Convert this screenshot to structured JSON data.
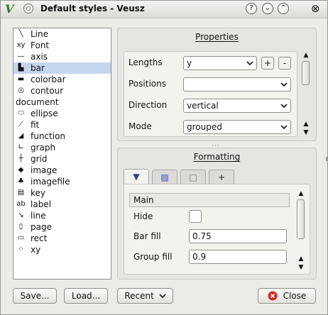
{
  "window": {
    "title": "Default styles - Veusz",
    "app_icon": "V"
  },
  "titlebar_buttons": [
    "help-icon",
    "minimize-icon",
    "maximize-icon",
    "close-icon"
  ],
  "title_glyphs": {
    "help": "?",
    "minimize": "⌄",
    "maximize": "⌃",
    "close": "⊗"
  },
  "list": {
    "items": [
      {
        "label": "Line",
        "icon": "line-icon",
        "glyph": "╲"
      },
      {
        "label": "Font",
        "icon": "font-icon",
        "glyph": "xy"
      },
      {
        "label": "axis",
        "icon": "axis-icon",
        "glyph": "—"
      },
      {
        "label": "bar",
        "icon": "bar-chart-icon",
        "glyph": "▙",
        "selected": true
      },
      {
        "label": "colorbar",
        "icon": "colorbar-icon",
        "glyph": "▬"
      },
      {
        "label": "contour",
        "icon": "contour-icon",
        "glyph": "◎"
      },
      {
        "label": "document",
        "icon": "",
        "glyph": ""
      },
      {
        "label": "ellipse",
        "icon": "ellipse-icon",
        "glyph": "⬭"
      },
      {
        "label": "fit",
        "icon": "fit-icon",
        "glyph": "⟋"
      },
      {
        "label": "function",
        "icon": "function-icon",
        "glyph": "◢"
      },
      {
        "label": "graph",
        "icon": "graph-icon",
        "glyph": "∟"
      },
      {
        "label": "grid",
        "icon": "grid-icon",
        "glyph": "┼"
      },
      {
        "label": "image",
        "icon": "image-icon",
        "glyph": "◆"
      },
      {
        "label": "imagefile",
        "icon": "imagefile-icon",
        "glyph": "♣"
      },
      {
        "label": "key",
        "icon": "key-icon",
        "glyph": "▤"
      },
      {
        "label": "label",
        "icon": "label-icon",
        "glyph": "ab"
      },
      {
        "label": "line",
        "icon": "arrow-line-icon",
        "glyph": "↘"
      },
      {
        "label": "page",
        "icon": "page-icon",
        "glyph": "▯"
      },
      {
        "label": "rect",
        "icon": "rect-icon",
        "glyph": "▭"
      },
      {
        "label": "xy",
        "icon": "xy-icon",
        "glyph": "⁘"
      }
    ]
  },
  "properties": {
    "title": "Properties",
    "rows": [
      {
        "label": "Lengths",
        "value": "y",
        "kind": "combo",
        "extra_buttons": [
          "+",
          "-"
        ]
      },
      {
        "label": "Positions",
        "value": "",
        "kind": "combo"
      },
      {
        "label": "Direction",
        "value": "vertical",
        "kind": "combo"
      },
      {
        "label": "Mode",
        "value": "grouped",
        "kind": "combo"
      }
    ]
  },
  "formatting": {
    "title": "Formatting",
    "tabs": [
      {
        "name": "main-tab",
        "glyph": "▼",
        "color": "#2a3a9c"
      },
      {
        "name": "fill-tab",
        "glyph": "▨",
        "color": "#3a48c8"
      },
      {
        "name": "border-tab",
        "glyph": "□",
        "color": "#777777"
      },
      {
        "name": "error-tab",
        "glyph": "+",
        "color": "#222222"
      }
    ],
    "section_header": "Main",
    "rows": [
      {
        "label": "Hide",
        "kind": "check",
        "value": ""
      },
      {
        "label": "Bar fill",
        "kind": "text",
        "value": "0.75"
      },
      {
        "label": "Group fill",
        "kind": "text",
        "value": "0.9"
      }
    ]
  },
  "buttons": {
    "save": "Save...",
    "load": "Load...",
    "recent": "Recent",
    "close": "Close"
  },
  "colors": {
    "selection": "#c5d7ef",
    "close_icon": "#cc2a22"
  }
}
